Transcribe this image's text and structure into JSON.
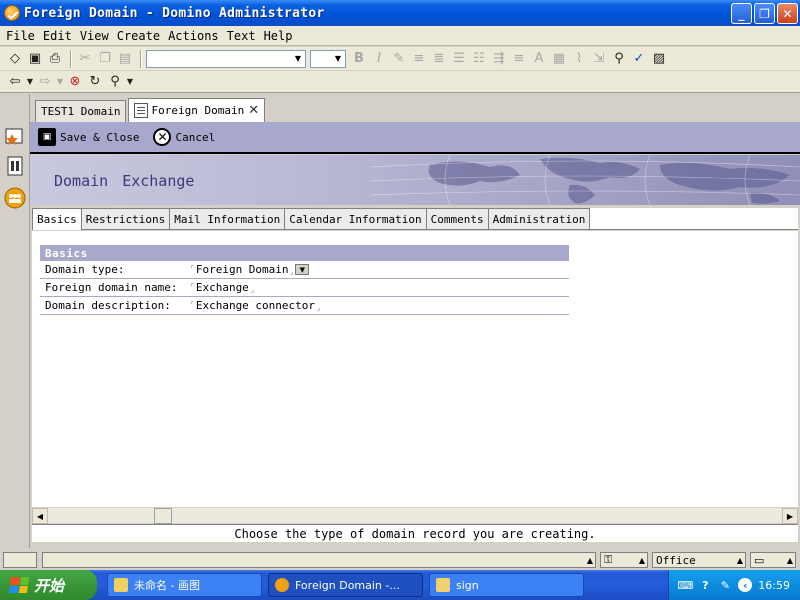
{
  "window": {
    "title": "Foreign Domain - Domino Administrator",
    "controls": [
      "minimize",
      "maximize",
      "close"
    ]
  },
  "menu": [
    "File",
    "Edit",
    "View",
    "Create",
    "Actions",
    "Text",
    "Help"
  ],
  "window_tabs": [
    {
      "label": "TEST1 Domain",
      "active": false
    },
    {
      "label": "Foreign Domain",
      "active": true
    }
  ],
  "actions": {
    "save_close": "Save & Close",
    "cancel": "Cancel"
  },
  "banner": {
    "word1": "Domain",
    "word2": "Exchange"
  },
  "form_tabs": [
    "Basics",
    "Restrictions",
    "Mail Information",
    "Calendar Information",
    "Comments",
    "Administration"
  ],
  "section": {
    "title": "Basics",
    "fields": [
      {
        "label": "Domain type:",
        "value": "Foreign Domain",
        "has_dropdown": true
      },
      {
        "label": "Foreign domain name:",
        "value": "Exchange",
        "has_dropdown": false
      },
      {
        "label": "Domain description:",
        "value": "Exchange connector",
        "has_dropdown": false
      }
    ]
  },
  "help_text": "Choose the type of domain record you are creating.",
  "status": {
    "location": "Office"
  },
  "taskbar": {
    "start_label": "开始",
    "tasks": [
      {
        "label": "未命名 - 画图",
        "active": false
      },
      {
        "label": "Foreign Domain -...",
        "active": true
      },
      {
        "label": "sign",
        "active": false
      }
    ],
    "clock": "16:59"
  },
  "colors": {
    "section_header": "#a8a8cc",
    "action_bar": "#a8a8cc",
    "banner_text": "#3a3a7a"
  }
}
